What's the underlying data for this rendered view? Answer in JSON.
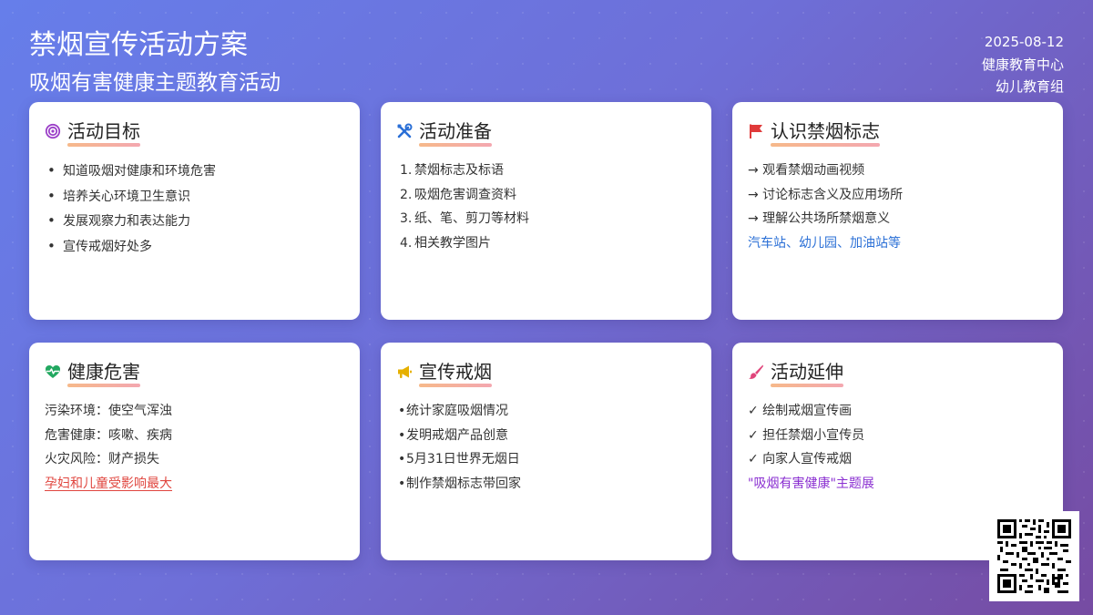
{
  "header": {
    "title": "禁烟宣传活动方案",
    "subtitle": "吸烟有害健康主题教育活动",
    "date": "2025-08-12",
    "org": "健康教育中心",
    "group": "幼儿教育组"
  },
  "colors": {
    "gradient_start": "#667eea",
    "gradient_end": "#764ba2",
    "accent_blue": "#2a6fd6",
    "accent_red": "#e0463f",
    "accent_purple": "#8a2fd1"
  },
  "cards": [
    {
      "title": "活动目标",
      "icon": "target-icon",
      "items": [
        "知道吸烟对健康和环境危害",
        "培养关心环境卫生意识",
        "发展观察力和表达能力",
        "宣传戒烟好处多"
      ]
    },
    {
      "title": "活动准备",
      "icon": "tools-icon",
      "items": [
        "禁烟标志及标语",
        "吸烟危害调查资料",
        "纸、笔、剪刀等材料",
        "相关教学图片"
      ],
      "numbers": [
        "1.",
        "2.",
        "3.",
        "4."
      ]
    },
    {
      "title": "认识禁烟标志",
      "icon": "flag-icon",
      "items": [
        "→ 观看禁烟动画视频",
        "→ 讨论标志含义及应用场所",
        "→ 理解公共场所禁烟意义"
      ],
      "highlight": "汽车站、幼儿园、加油站等"
    },
    {
      "title": "健康危害",
      "icon": "heartbeat-icon",
      "items": [
        "污染环境：使空气浑浊",
        "危害健康：咳嗽、疾病",
        "火灾风险：财产损失"
      ],
      "highlight": "孕妇和儿童受影响最大"
    },
    {
      "title": "宣传戒烟",
      "icon": "megaphone-icon",
      "items": [
        "统计家庭吸烟情况",
        "发明戒烟产品创意",
        "5月31日世界无烟日",
        "制作禁烟标志带回家"
      ]
    },
    {
      "title": "活动延伸",
      "icon": "paintbrush-icon",
      "items": [
        "✓ 绘制戒烟宣传画",
        "✓ 担任禁烟小宣传员",
        "✓ 向家人宣传戒烟"
      ],
      "highlight": "\"吸烟有害健康\"主题展"
    }
  ]
}
